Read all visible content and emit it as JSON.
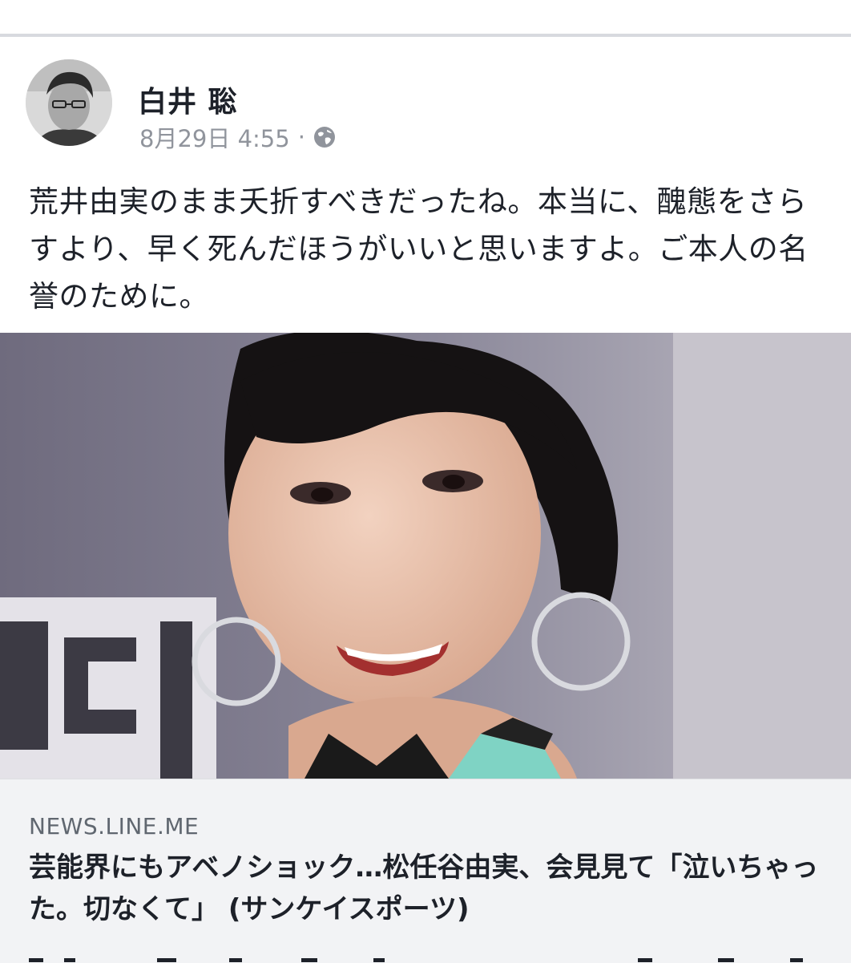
{
  "post": {
    "author": "白井 聡",
    "date": "8月29日 4:55",
    "separator": "·",
    "privacy_icon": "globe-icon",
    "text": "荒井由実のまま夭折すべきだったね。本当に、醜態をさらすより、早く死んだほうがいいと思いますよ。ご本人の名誉のために。"
  },
  "link_preview": {
    "domain": "NEWS.LINE.ME",
    "title": "芸能界にもアベノショック…松任谷由実、会見見て「泣いちゃった。切なくて」 (サンケイスポーツ)"
  },
  "colors": {
    "name": "#1d2129",
    "meta": "#90949c",
    "caption_bg": "#f2f3f5",
    "divider": "#d8dadf"
  }
}
